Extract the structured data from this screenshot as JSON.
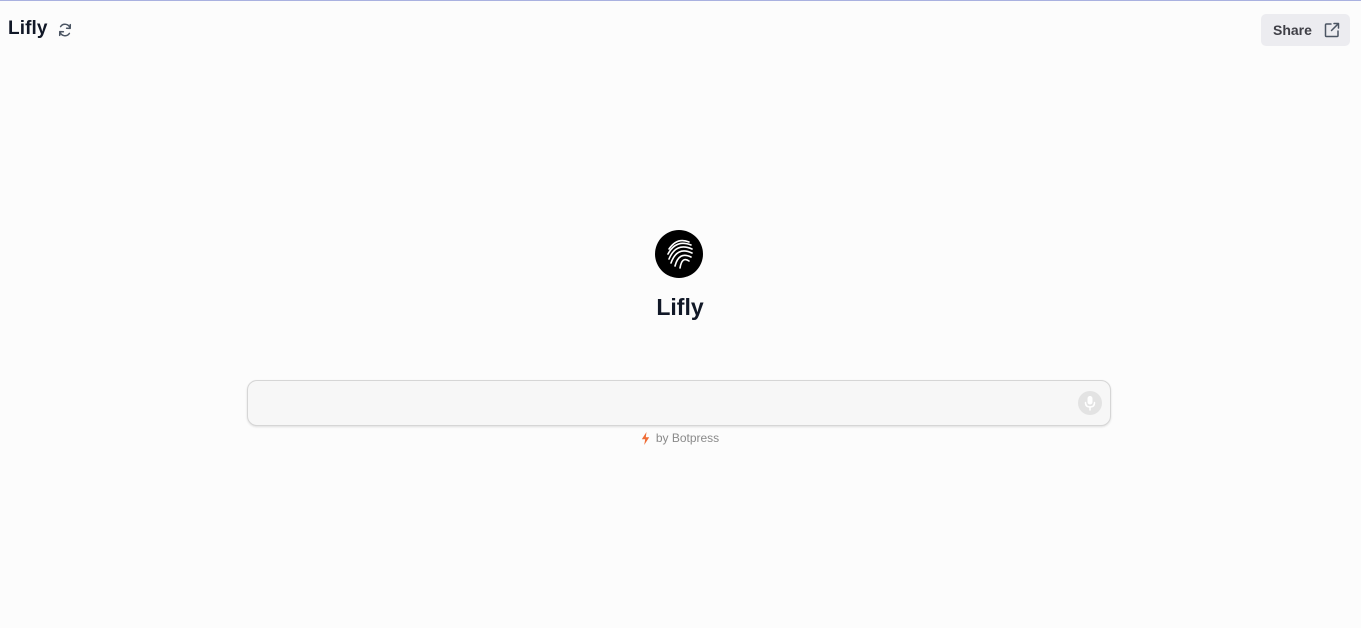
{
  "header": {
    "title": "Lifly",
    "refresh_icon": "refresh-icon",
    "share_label": "Share",
    "share_icon": "external-link-icon"
  },
  "bot": {
    "name": "Lifly",
    "avatar_icon": "lifly-logo-icon"
  },
  "composer": {
    "value": "",
    "placeholder": "",
    "mic_icon": "microphone-icon"
  },
  "footer": {
    "powered_by": "by Botpress",
    "bolt_icon": "lightning-bolt-icon",
    "bolt_color": "#ef6c35"
  },
  "colors": {
    "background": "#fcfcfc",
    "share_button_bg": "#ececf0",
    "top_rule": "#a9b1e0"
  }
}
